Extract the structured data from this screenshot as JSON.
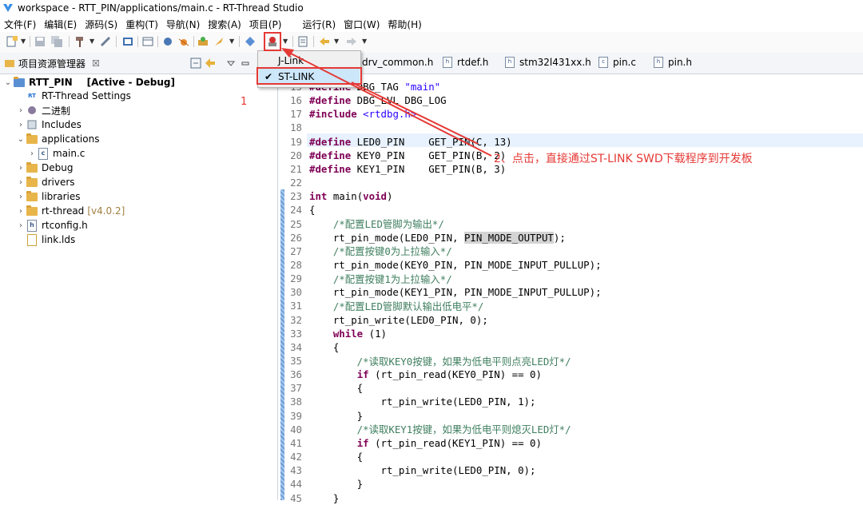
{
  "window": {
    "title": "workspace - RTT_PIN/applications/main.c - RT-Thread Studio"
  },
  "menubar": [
    "文件(F)",
    "编辑(E)",
    "源码(S)",
    "重构(T)",
    "导航(N)",
    "搜索(A)",
    "项目(P)",
    "运行(R)",
    "窗口(W)",
    "帮助(H)"
  ],
  "toolbar": {
    "icons": [
      "new-icon",
      "save-icon",
      "save-all-icon",
      "build-icon",
      "tools-icon",
      "console-icon",
      "window-icon",
      "debug-icon",
      "bug-icon",
      "plugin-icon",
      "rocket-icon",
      "sdk-icon",
      "download-icon",
      "layout-icon",
      "back-icon",
      "forward-icon"
    ],
    "highlight_color": "#e53935"
  },
  "download_menu": {
    "items": [
      {
        "label": "J-Link",
        "checked": false
      },
      {
        "label": "ST-LINK",
        "checked": true
      }
    ],
    "check_mark": "✔"
  },
  "project_explorer": {
    "tab_label": "项目资源管理器",
    "tab_close": "☒",
    "project": {
      "name": "RTT_PIN",
      "status": "[Active - Debug]"
    },
    "items": [
      {
        "label": "RT-Thread Settings",
        "icon": "rt-settings-icon",
        "depth": 1,
        "expander": ""
      },
      {
        "label": "二进制",
        "icon": "binary-icon",
        "depth": 1,
        "expander": "›"
      },
      {
        "label": "Includes",
        "icon": "includes-icon",
        "depth": 1,
        "expander": "›"
      },
      {
        "label": "applications",
        "icon": "folder-icon",
        "depth": 1,
        "expander": "⌄"
      },
      {
        "label": "main.c",
        "icon": "c-file-icon",
        "depth": 2,
        "expander": "›"
      },
      {
        "label": "Debug",
        "icon": "folder-icon",
        "depth": 1,
        "expander": "›"
      },
      {
        "label": "drivers",
        "icon": "folder-icon",
        "depth": 1,
        "expander": "›"
      },
      {
        "label": "libraries",
        "icon": "folder-icon",
        "depth": 1,
        "expander": "›"
      },
      {
        "label": "rt-thread",
        "icon": "folder-icon",
        "depth": 1,
        "expander": "›",
        "suffix": "[v4.0.2]"
      },
      {
        "label": "rtconfig.h",
        "icon": "h-file-icon",
        "depth": 1,
        "expander": "›"
      },
      {
        "label": "link.lds",
        "icon": "lds-file-icon",
        "depth": 1,
        "expander": ""
      }
    ]
  },
  "editor_tabs": [
    "drv_common.h",
    "rtdef.h",
    "stm32l431xx.h",
    "pin.c",
    "pin.h"
  ],
  "code_lines": [
    {
      "n": "15",
      "t": "#define DBG_TAG \"main\""
    },
    {
      "n": "16",
      "t": "#define DBG_LVL DBG_LOG"
    },
    {
      "n": "17",
      "t": "#include <rtdbg.h>"
    },
    {
      "n": "18",
      "t": ""
    },
    {
      "n": "19",
      "t": "#define LED0_PIN    GET_PIN(C, 13)"
    },
    {
      "n": "20",
      "t": "#define KEY0_PIN    GET_PIN(B, 2)"
    },
    {
      "n": "21",
      "t": "#define KEY1_PIN    GET_PIN(B, 3)"
    },
    {
      "n": "22",
      "t": ""
    },
    {
      "n": "23",
      "t": "int main(void)"
    },
    {
      "n": "24",
      "t": "{"
    },
    {
      "n": "25",
      "t": "    /*配置LED管脚为输出*/"
    },
    {
      "n": "26",
      "t": "    rt_pin_mode(LED0_PIN, PIN_MODE_OUTPUT);"
    },
    {
      "n": "27",
      "t": "    /*配置按键0为上拉输入*/"
    },
    {
      "n": "28",
      "t": "    rt_pin_mode(KEY0_PIN, PIN_MODE_INPUT_PULLUP);"
    },
    {
      "n": "29",
      "t": "    /*配置按键1为上拉输入*/"
    },
    {
      "n": "30",
      "t": "    rt_pin_mode(KEY1_PIN, PIN_MODE_INPUT_PULLUP);"
    },
    {
      "n": "31",
      "t": "    /*配置LED管脚默认输出低电平*/"
    },
    {
      "n": "32",
      "t": "    rt_pin_write(LED0_PIN, 0);"
    },
    {
      "n": "33",
      "t": "    while (1)"
    },
    {
      "n": "34",
      "t": "    {"
    },
    {
      "n": "35",
      "t": "        /*读取KEY0按键，如果为低电平则点亮LED灯*/"
    },
    {
      "n": "36",
      "t": "        if (rt_pin_read(KEY0_PIN) == 0)"
    },
    {
      "n": "37",
      "t": "        {"
    },
    {
      "n": "38",
      "t": "            rt_pin_write(LED0_PIN, 1);"
    },
    {
      "n": "39",
      "t": "        }"
    },
    {
      "n": "40",
      "t": "        /*读取KEY1按键，如果为低电平则熄灭LED灯*/"
    },
    {
      "n": "41",
      "t": "        if (rt_pin_read(KEY1_PIN) == 0)"
    },
    {
      "n": "42",
      "t": "        {"
    },
    {
      "n": "43",
      "t": "            rt_pin_write(LED0_PIN, 0);"
    },
    {
      "n": "44",
      "t": "        }"
    },
    {
      "n": "45",
      "t": "    }"
    }
  ],
  "annotations": {
    "marker_1": "1",
    "step_2_text": "2、点击，直接通过ST-LINK SWD下载程序到开发板",
    "color": "#e53935"
  }
}
